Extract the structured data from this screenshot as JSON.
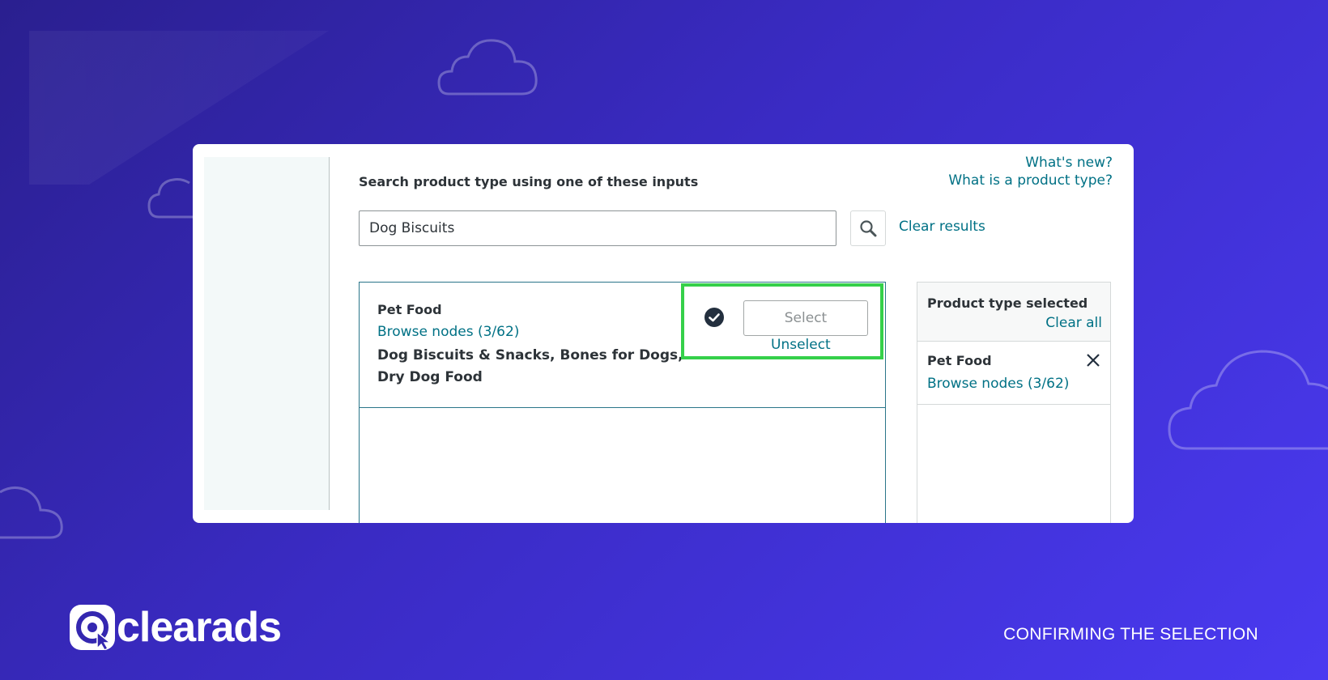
{
  "header": {
    "whats_new": "What's new?",
    "what_is_product_type": "What is a product type?"
  },
  "search": {
    "heading": "Search product type using one of these inputs",
    "value": "Dog Biscuits",
    "clear_results": "Clear results"
  },
  "result": {
    "title": "Pet Food",
    "browse_nodes": "Browse nodes (3/62)",
    "description": "Dog Biscuits & Snacks, Bones for Dogs, Dry Dog Food",
    "select_label": "Select",
    "unselect_label": "Unselect",
    "selected": true
  },
  "selected_panel": {
    "title": "Product type selected",
    "clear_all": "Clear all",
    "items": [
      {
        "title": "Pet Food",
        "browse_nodes": "Browse nodes (3/62)"
      }
    ]
  },
  "branding": {
    "logo_text": "clearads",
    "caption": "CONFIRMING THE SELECTION"
  },
  "colors": {
    "link": "#007185",
    "highlight": "#35d04a",
    "background_start": "#2a1f8f",
    "background_end": "#4a3af0"
  },
  "icons": [
    "search-icon",
    "check-circle-icon",
    "close-icon",
    "cloud-icon",
    "clearads-logo-icon"
  ]
}
